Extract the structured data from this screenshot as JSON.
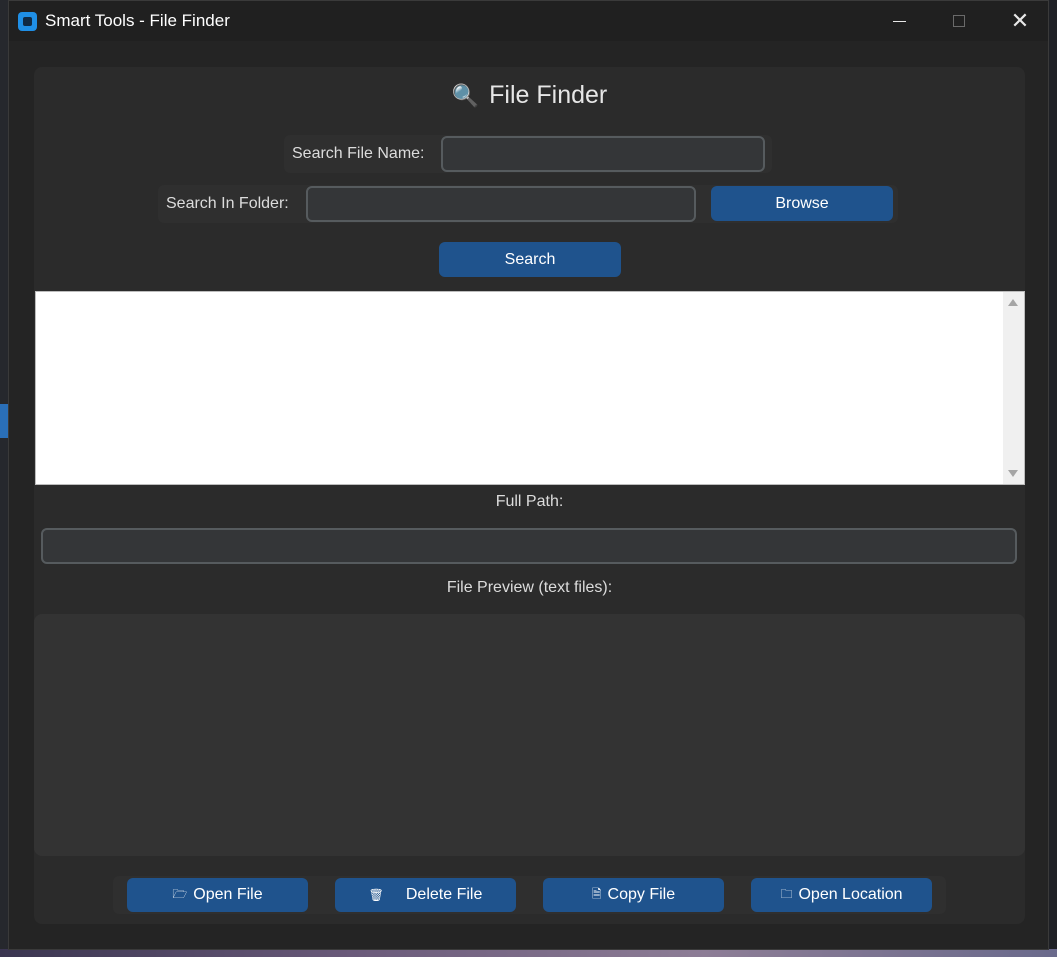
{
  "window": {
    "title": "Smart Tools - File Finder",
    "controls": {
      "minimize": "minimize",
      "maximize": "maximize",
      "close": "close"
    }
  },
  "header": {
    "icon": "magnifier-icon",
    "title": "File Finder"
  },
  "search": {
    "file_name_label": "Search File Name:",
    "file_name_value": "",
    "folder_label": "Search In Folder:",
    "folder_value": "",
    "browse_label": "Browse",
    "search_label": "Search"
  },
  "results": {
    "items": []
  },
  "full_path": {
    "label": "Full Path:",
    "value": ""
  },
  "preview": {
    "label": "File Preview (text files):",
    "content": ""
  },
  "actions": {
    "open_file": "Open File",
    "delete_file": "Delete File",
    "copy_file": "Copy File",
    "open_location": "Open Location"
  },
  "colors": {
    "accent": "#1f538d",
    "window_bg": "#242424",
    "frame_bg": "#2b2b2b",
    "entry_bg": "#343638",
    "entry_border": "#565b5e"
  }
}
